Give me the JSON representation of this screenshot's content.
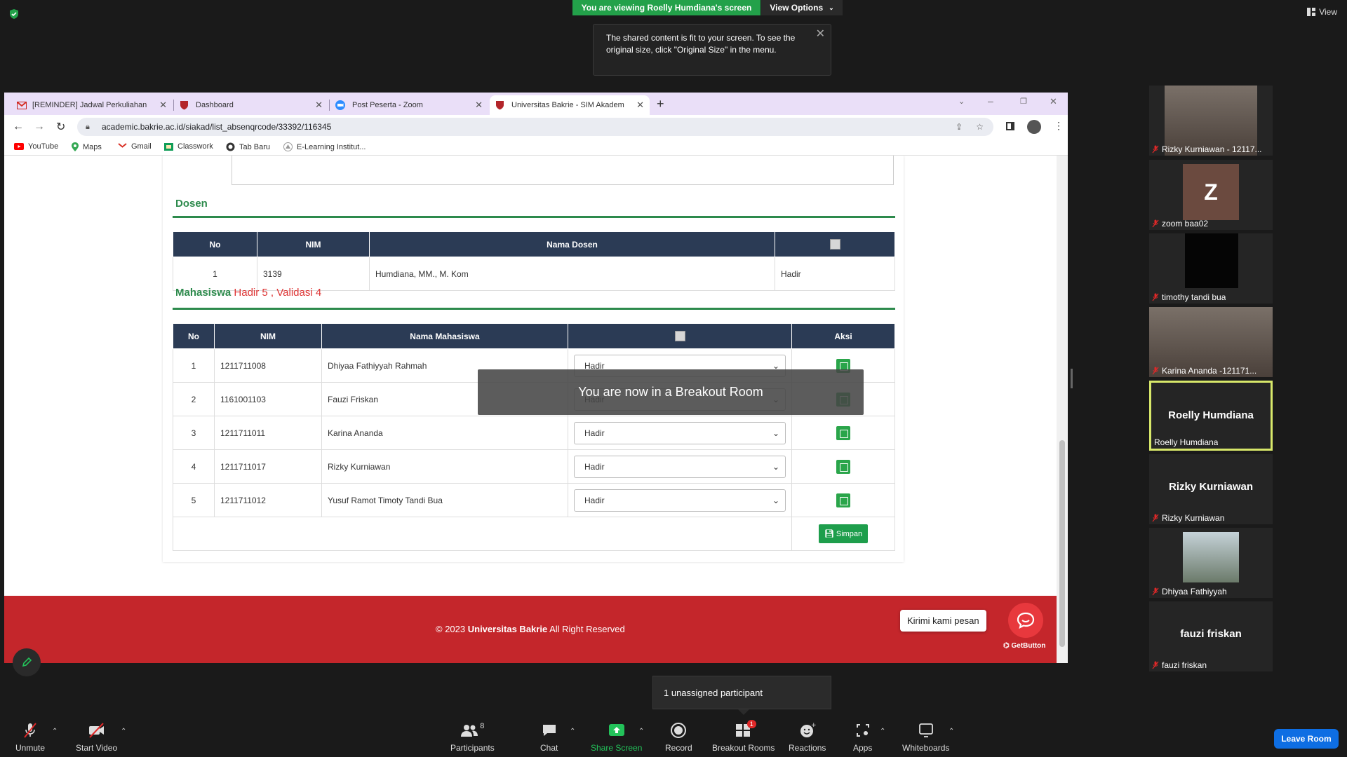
{
  "zoom_top": {
    "viewing_text": "You are viewing Roelly Humdiana's screen",
    "view_options": "View Options",
    "popup_text": "The shared content is fit to your screen. To see the original size, click \"Original Size\" in the menu.",
    "view_label": "View"
  },
  "browser": {
    "tabs": [
      {
        "label": "[REMINDER] Jadwal Perkuliahan",
        "icon": "gmail-icon"
      },
      {
        "label": "Dashboard",
        "icon": "bakrie-shield-icon"
      },
      {
        "label": "Post Peserta - Zoom",
        "icon": "zoom-icon"
      },
      {
        "label": "Universitas Bakrie - SIM Akadem",
        "icon": "bakrie-shield-icon"
      }
    ],
    "url": "academic.bakrie.ac.id/siakad/list_absenqrcode/33392/116345",
    "bookmarks": [
      "YouTube",
      "Maps",
      "Gmail",
      "Classwork",
      "Tab Baru",
      "E-Learning Institut..."
    ]
  },
  "page": {
    "dosen_title": "Dosen",
    "dosen_headers": [
      "No",
      "NIM",
      "Nama Dosen"
    ],
    "dosen_rows": [
      {
        "no": "1",
        "nim": "3139",
        "nama": "Humdiana, MM., M. Kom",
        "status": "Hadir"
      }
    ],
    "mhs_title": "Mahasiswa",
    "mhs_hadir": "Hadir 5",
    "mhs_sep": ",",
    "mhs_validasi": "Validasi 4",
    "mhs_headers": [
      "No",
      "NIM",
      "Nama Mahasiswa",
      "Aksi"
    ],
    "mhs_rows": [
      {
        "no": "1",
        "nim": "1211711008",
        "nama": "Dhiyaa Fathiyyah Rahmah",
        "status": "Hadir"
      },
      {
        "no": "2",
        "nim": "1161001103",
        "nama": "Fauzi Friskan",
        "status": "Hadir"
      },
      {
        "no": "3",
        "nim": "1211711011",
        "nama": "Karina Ananda",
        "status": "Hadir"
      },
      {
        "no": "4",
        "nim": "1211711017",
        "nama": "Rizky Kurniawan",
        "status": "Hadir"
      },
      {
        "no": "5",
        "nim": "1211711012",
        "nama": "Yusuf Ramot Timoty Tandi Bua",
        "status": "Hadir"
      }
    ],
    "simpan": "Simpan",
    "footer_prefix": "© 2023 ",
    "footer_brand": "Universitas Bakrie",
    "footer_suffix": " All Right Reserved",
    "chat_bubble": "Kirimi kami pesan",
    "getbutton": "GetButton"
  },
  "breakout_toast": "You are now in a Breakout Room",
  "participants": [
    {
      "name": "Rizky Kurniawan - 12117...",
      "type": "video",
      "muted": true
    },
    {
      "name": "zoom baa02",
      "type": "avatar",
      "initial": "Z",
      "muted": true
    },
    {
      "name": "timothy tandi bua",
      "type": "video-dark",
      "muted": true
    },
    {
      "name": "Karina Ananda -121171...",
      "type": "video",
      "muted": true
    },
    {
      "name": "Roelly Humdiana",
      "big": "Roelly Humdiana",
      "type": "name",
      "muted": false,
      "active": true
    },
    {
      "name": "Rizky Kurniawan",
      "big": "Rizky Kurniawan",
      "type": "name",
      "muted": true
    },
    {
      "name": "Dhiyaa Fathiyyah",
      "type": "photo",
      "muted": true
    },
    {
      "name": "fauzi friskan",
      "big": "fauzi friskan",
      "type": "name",
      "muted": true
    }
  ],
  "toolbar": {
    "unmute": "Unmute",
    "start_video": "Start Video",
    "participants": "Participants",
    "participants_count": "8",
    "chat": "Chat",
    "share_screen": "Share Screen",
    "record": "Record",
    "breakout_rooms": "Breakout Rooms",
    "breakout_badge": "1",
    "reactions": "Reactions",
    "apps": "Apps",
    "whiteboards": "Whiteboards",
    "leave_room": "Leave Room",
    "unassigned": "1 unassigned participant"
  },
  "colors": {
    "zoom_green": "#23a14a",
    "bakrie_red": "#c4262b",
    "table_header": "#2b3b55",
    "zoom_blue": "#0e6ee3"
  }
}
